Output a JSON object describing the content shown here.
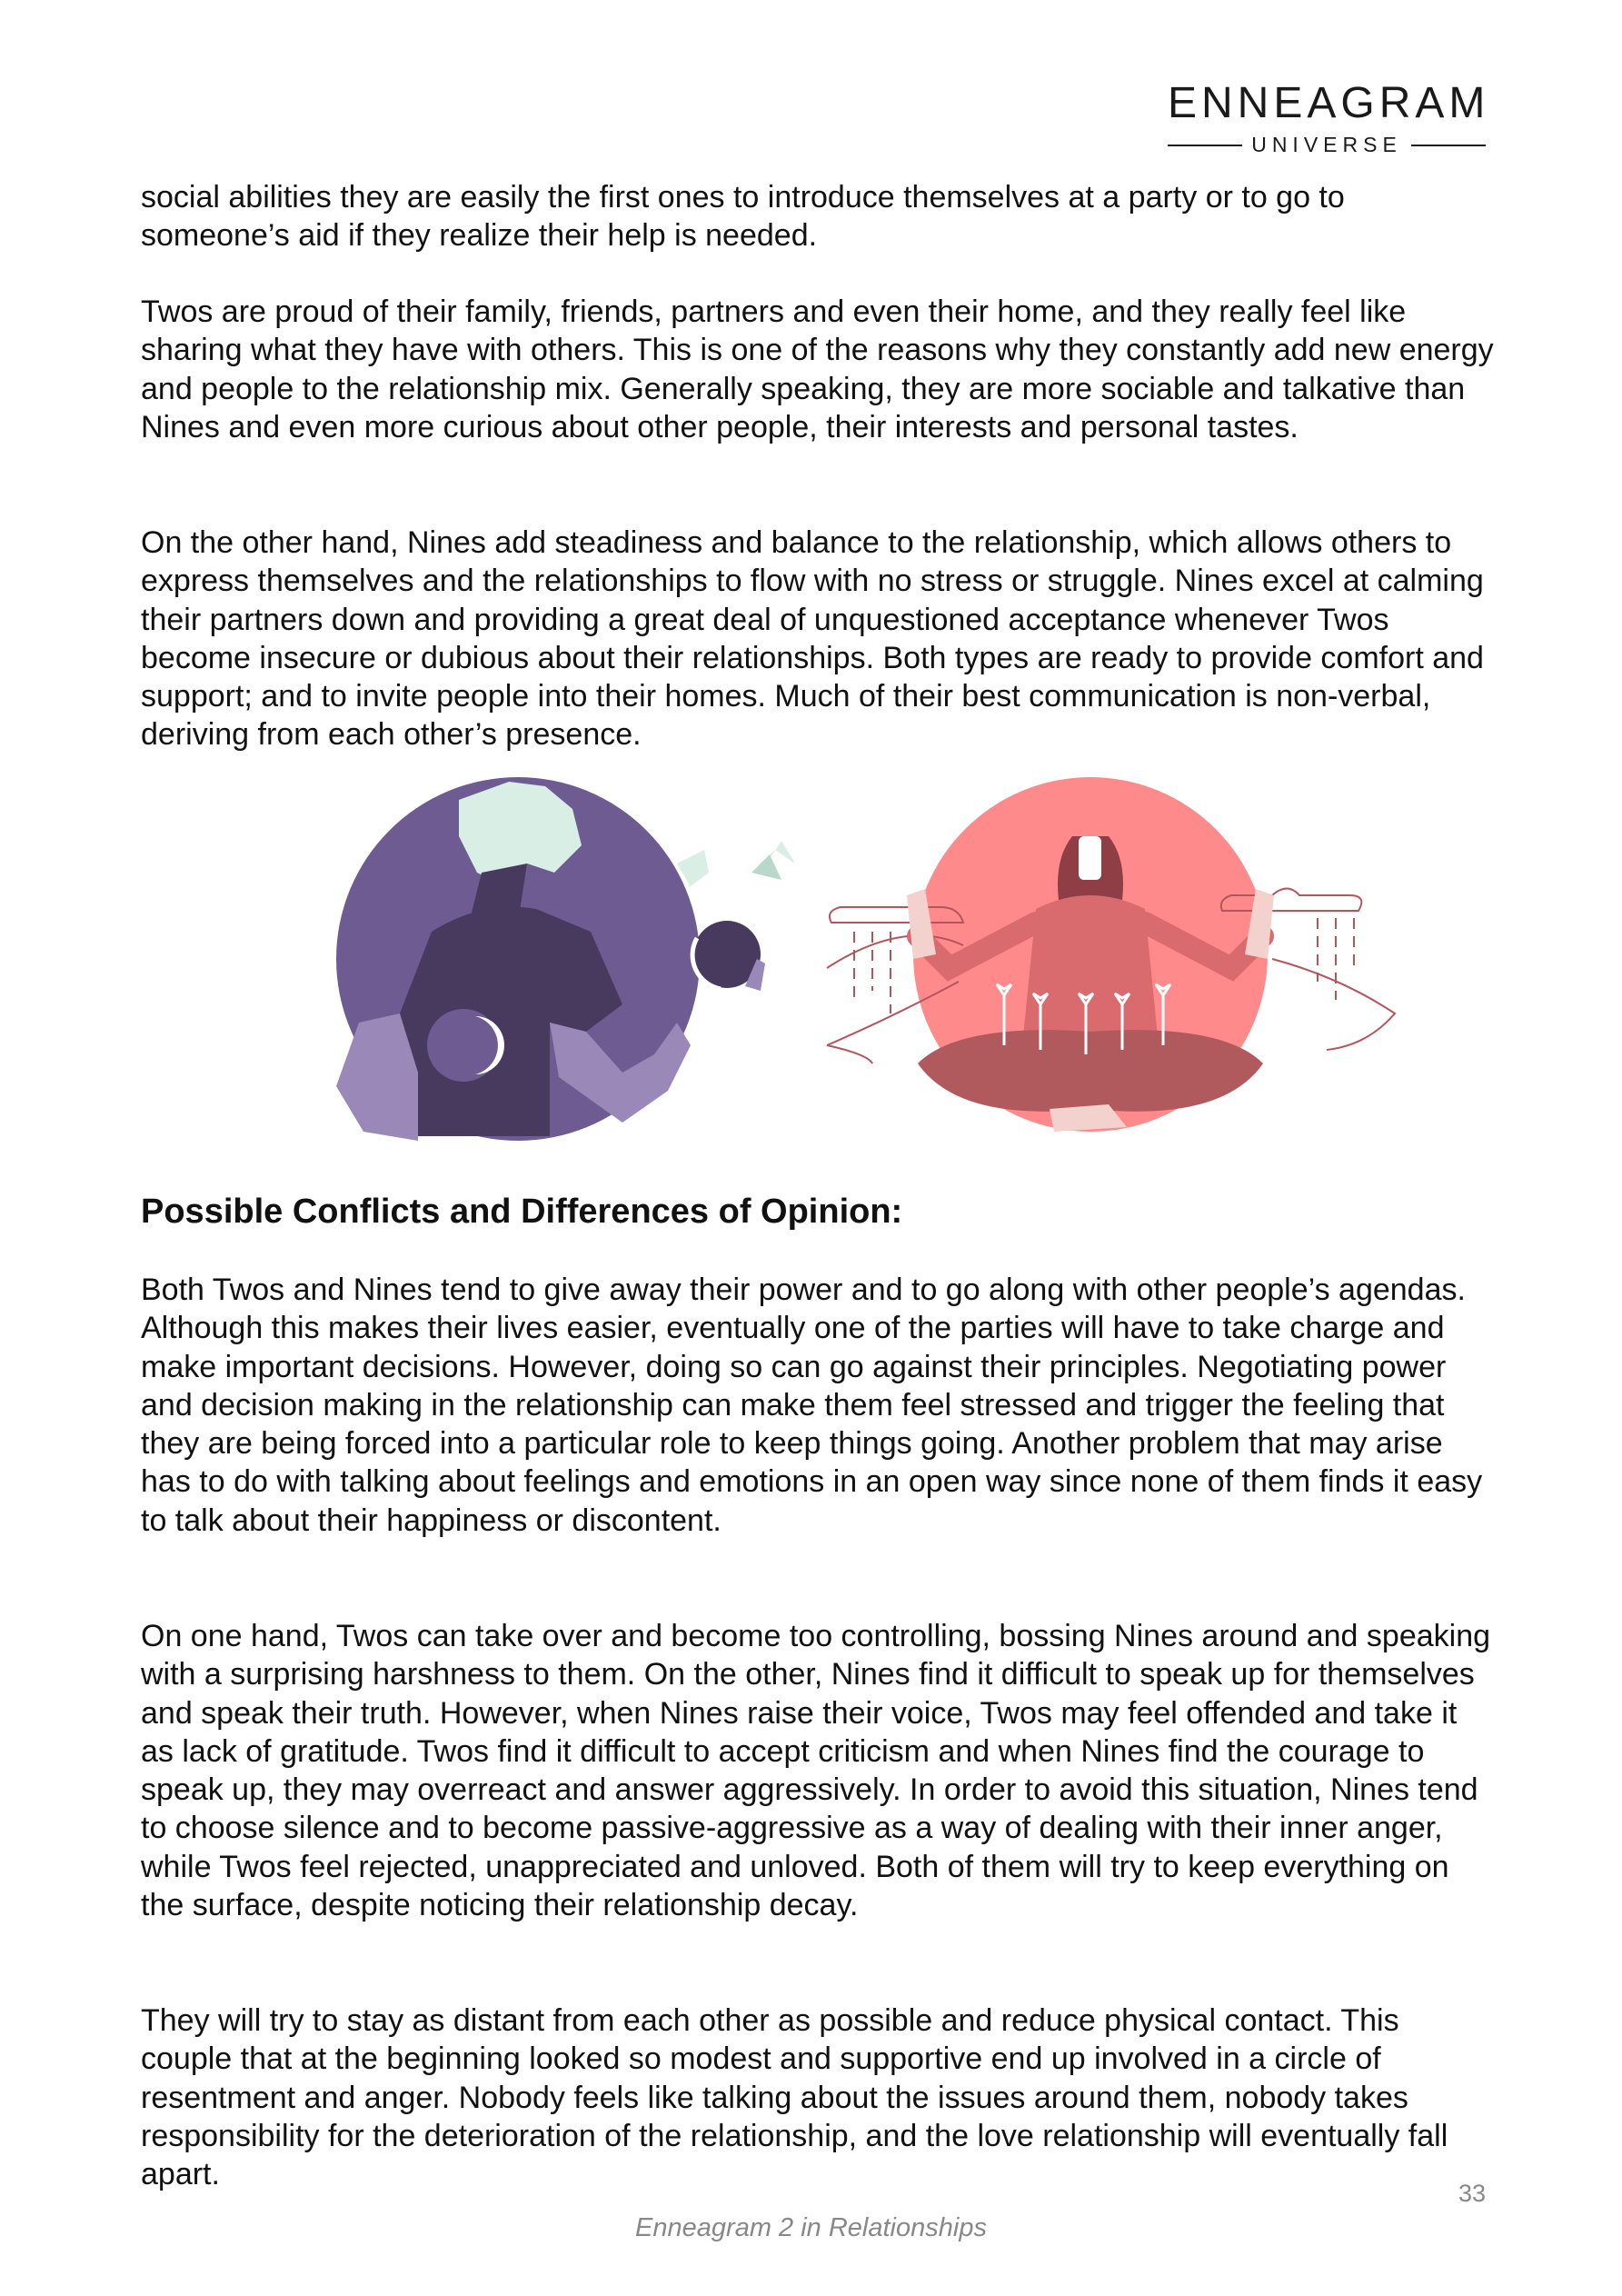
{
  "header": {
    "logo_title": "ENNEAGRAM",
    "logo_subtitle": "UNIVERSE"
  },
  "body": {
    "paragraph_1": "social abilities they are easily the first ones to introduce themselves at a party or to go to someone’s aid if they realize their help is needed.",
    "paragraph_2": "Twos are proud of their family, friends, partners and even their home, and they really feel like sharing what they have with others. This is one of the reasons why they constantly add new energy and people to the relationship mix. Generally speaking, they are more sociable and talkative than Nines and even more curious about other people, their interests and personal tastes.",
    "paragraph_3": "On the other hand, Nines add steadiness and balance to the relationship, which allows others to express themselves and the relationships to flow with no stress or struggle. Nines excel at calming their partners down and providing a great deal of unquestioned acceptance whenever Twos become insecure or dubious about their relationships. Both types are ready to provide comfort and support; and to invite people into their homes. Much of their best communication is non-verbal, deriving from each other’s presence.",
    "section_heading": "Possible Conflicts and Differences of Opinion:",
    "paragraph_4": "Both Twos and Nines tend to give away their power and to go along with other people’s agendas. Although this makes their lives easier, eventually one of the parties will have to take charge and make important decisions. However, doing so can go against their principles. Negotiating power and decision making in the relationship can make them feel stressed and trigger the feeling that they are being forced into a particular role to keep things going. Another problem that may arise has to do with talking about feelings and emotions in an open way since none of them finds it easy to talk about their happiness or discontent.",
    "paragraph_5": "On one hand, Twos can take over and become too controlling, bossing Nines around and speaking with a surprising harshness to them. On the other, Nines find it difficult to speak up for themselves and speak their truth. However, when Nines raise their voice, Twos may feel offended and take it as lack of gratitude. Twos find it difficult to accept criticism and when Nines find the courage to speak up, they may overreact and answer aggressively. In order to avoid this situation, Nines tend to choose silence and to become passive-aggressive as a way of dealing with their inner anger, while Twos feel rejected, unappreciated and unloved. Both of them will try to keep everything on the surface, despite noticing their relationship decay.",
    "paragraph_6": "They will try to stay as distant from each other as possible and reduce physical contact. This couple that at the beginning looked so modest and supportive end up involved in a circle of resentment and anger. Nobody feels like talking about the issues around them, nobody takes responsibility for the deterioration of the relationship, and the love relationship will eventually fall apart."
  },
  "footer": {
    "page_number": "33",
    "book_title": "Enneagram 2 in Relationships"
  },
  "colors": {
    "purple_circle": "#6e5b92",
    "dark_purple": "#473a5e",
    "light_purple": "#9a88b8",
    "mint": "#d9eee5",
    "coral_circle": "#ff8a8c",
    "rose": "#b05a5e",
    "rose_line": "#b3565c"
  }
}
